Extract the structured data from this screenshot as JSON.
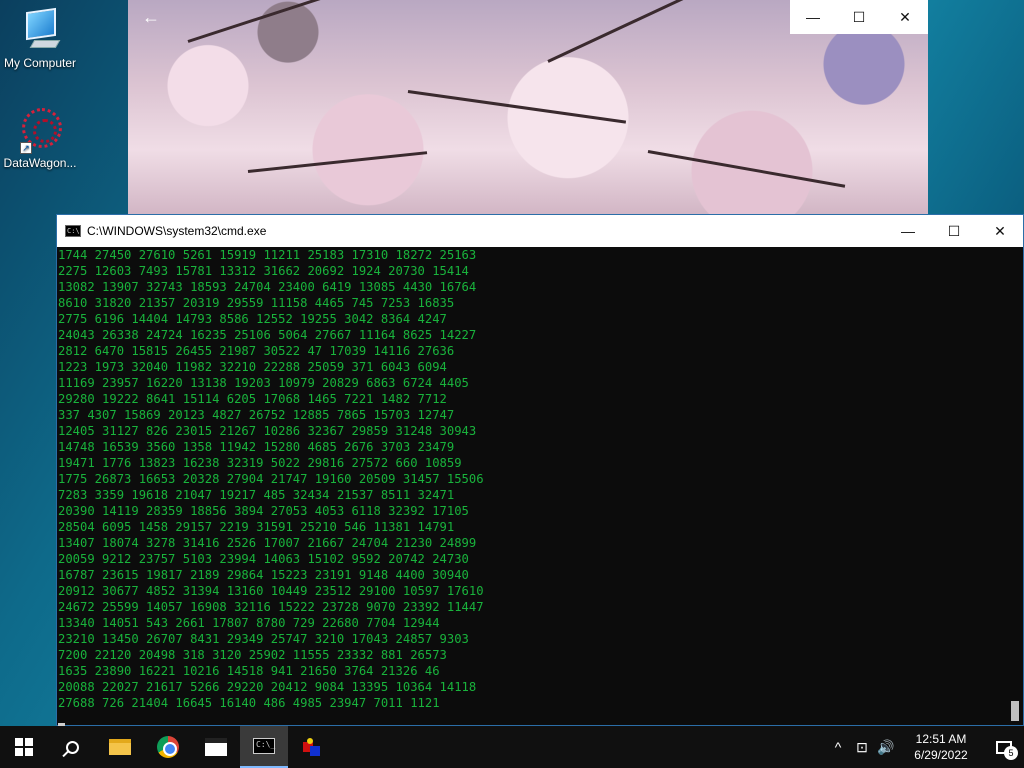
{
  "desktop": {
    "icons": [
      {
        "label": "My Computer"
      },
      {
        "label": "DataWagon..."
      }
    ]
  },
  "photo_viewer": {
    "back_glyph": "←",
    "controls": {
      "minimize": "—",
      "maximize": "☐",
      "close": "✕"
    }
  },
  "cmd": {
    "title": "C:\\WINDOWS\\system32\\cmd.exe",
    "icon_text": "C:\\",
    "controls": {
      "minimize": "—",
      "maximize": "☐",
      "close": "✕"
    },
    "lines": [
      "1744 27450 27610 5261 15919 11211 25183 17310 18272 25163",
      "2275 12603 7493 15781 13312 31662 20692 1924 20730 15414",
      "13082 13907 32743 18593 24704 23400 6419 13085 4430 16764",
      "8610 31820 21357 20319 29559 11158 4465 745 7253 16835",
      "2775 6196 14404 14793 8586 12552 19255 3042 8364 4247",
      "24043 26338 24724 16235 25106 5064 27667 11164 8625 14227",
      "2812 6470 15815 26455 21987 30522 47 17039 14116 27636",
      "1223 1973 32040 11982 32210 22288 25059 371 6043 6094",
      "11169 23957 16220 13138 19203 10979 20829 6863 6724 4405",
      "29280 19222 8641 15114 6205 17068 1465 7221 1482 7712",
      "337 4307 15869 20123 4827 26752 12885 7865 15703 12747",
      "12405 31127 826 23015 21267 10286 32367 29859 31248 30943",
      "14748 16539 3560 1358 11942 15280 4685 2676 3703 23479",
      "19471 1776 13823 16238 32319 5022 29816 27572 660 10859",
      "1775 26873 16653 20328 27904 21747 19160 20509 31457 15506",
      "7283 3359 19618 21047 19217 485 32434 21537 8511 32471",
      "20390 14119 28359 18856 3894 27053 4053 6118 32392 17105",
      "28504 6095 1458 29157 2219 31591 25210 546 11381 14791",
      "13407 18074 3278 31416 2526 17007 21667 24704 21230 24899",
      "20059 9212 23757 5103 23994 14063 15102 9592 20742 24730",
      "16787 23615 19817 2189 29864 15223 23191 9148 4400 30940",
      "20912 30677 4852 31394 13160 10449 23512 29100 10597 17610",
      "24672 25599 14057 16908 32116 15222 23728 9070 23392 11447",
      "13340 14051 543 2661 17807 8780 729 22680 7704 12944",
      "23210 13450 26707 8431 29349 25747 3210 17043 24857 9303",
      "7200 22120 20498 318 3120 25902 11555 23332 881 26573",
      "1635 23890 16221 10216 14518 941 21650 3764 21326 46",
      "20088 22027 21617 5266 29220 20412 9084 13395 10364 14118",
      "27688 726 21404 16645 16140 486 4985 23947 7011 1121"
    ]
  },
  "taskbar": {
    "cmd_icon_text": "C:\\_",
    "tray": {
      "chevron": "^",
      "network": "⊡",
      "volume": "🔊",
      "time": "12:51 AM",
      "date": "6/29/2022",
      "notification_count": "5"
    }
  },
  "colors": {
    "console_text": "#19b33c",
    "console_bg": "#0c0c0c",
    "taskbar_bg": "#101010"
  }
}
